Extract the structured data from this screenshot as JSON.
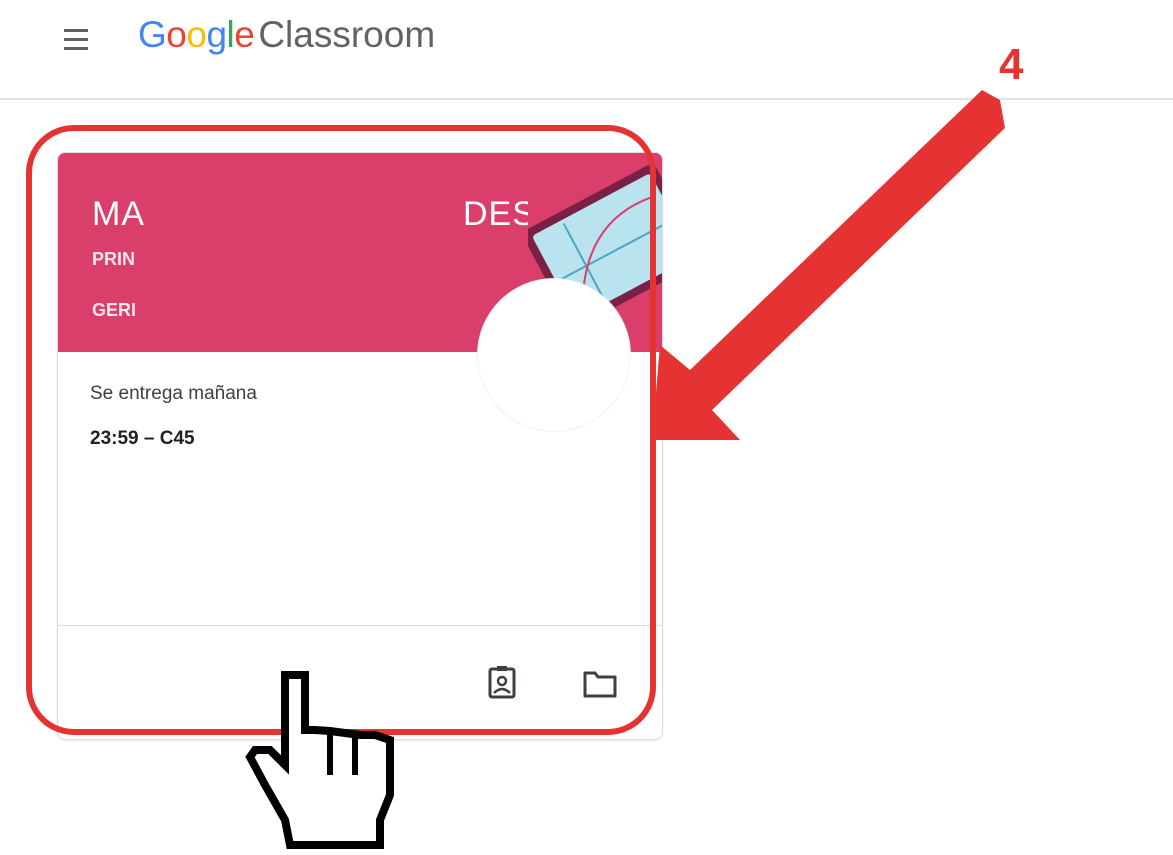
{
  "app": {
    "brand_google_letters": [
      "G",
      "o",
      "o",
      "g",
      "l",
      "e"
    ],
    "brand_product": "Classroom",
    "colors": {
      "google_blue": "#4285f4",
      "google_red": "#ea4335",
      "google_yellow": "#fbbc05",
      "google_green": "#34a853",
      "card_header": "#d93f6a",
      "annotation_red": "#e53333"
    }
  },
  "topbar": {
    "menu_icon": "hamburger-menu-icon"
  },
  "card": {
    "title_left": "MA",
    "title_right": "DES",
    "line1": "PRIN",
    "line2": "GERI",
    "due_label": "Se entrega mañana",
    "due_time": "23:59 – C45",
    "footer_icons": [
      "portfolio-icon",
      "folder-icon"
    ]
  },
  "annotation": {
    "step_number": "4"
  }
}
